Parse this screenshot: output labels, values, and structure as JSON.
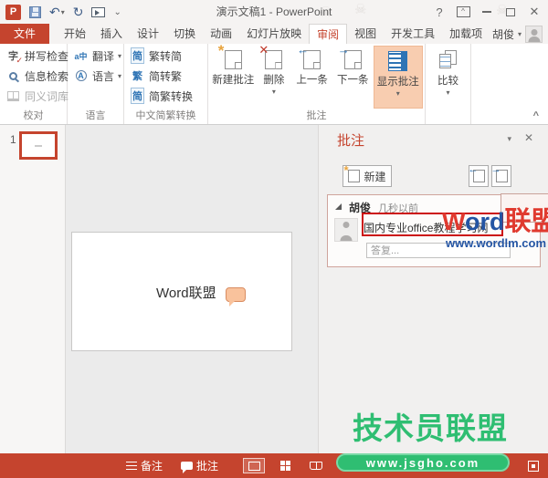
{
  "window": {
    "title": "演示文稿1 - PowerPoint",
    "help": "?",
    "close": "✕"
  },
  "qat": {
    "powerpoint_badge": "P",
    "undo": "↶",
    "redo": "↻",
    "more": "⌄"
  },
  "icons": {
    "caret": "▾",
    "collapse_ribbon": "^",
    "pane_menu": "▾",
    "pane_close": "✕",
    "star": "*",
    "cross": "✕",
    "arrow_left": "←",
    "arrow_right": "→",
    "check": "✓",
    "zi": "字",
    "translate": "a中",
    "globe_letter": "A",
    "jian": "简",
    "fan": "繁",
    "jianfan": "简",
    "skull": "☠"
  },
  "tabs": {
    "file": "文件",
    "home": "开始",
    "insert": "插入",
    "design": "设计",
    "transitions": "切换",
    "animations": "动画",
    "slideshow": "幻灯片放映",
    "review": "审阅",
    "view": "视图",
    "developer": "开发工具",
    "addins": "加载项",
    "account": "胡俊"
  },
  "ribbon": {
    "proofing": {
      "label": "校对",
      "spell": "拼写检查",
      "research": "信息检索",
      "thesaurus": "同义词库"
    },
    "language": {
      "label": "语言",
      "translate": "翻译",
      "language": "语言"
    },
    "conversion": {
      "label": "中文简繁转换",
      "t2s": "繁转简",
      "s2t": "简转繁",
      "convert": "简繁转换"
    },
    "comments": {
      "label": "批注",
      "new": "新建批注",
      "delete": "删除",
      "previous": "上一条",
      "next": "下一条",
      "show": "显示批注"
    },
    "compare": {
      "label": "比较"
    }
  },
  "thumbnails": {
    "slide_number": "1"
  },
  "slide": {
    "text": "Word联盟"
  },
  "comments_pane": {
    "title": "批注",
    "new_button": "新建",
    "author": "胡俊",
    "time": "几秒以前",
    "comment_text": "国内专业office教程学习网",
    "reply_placeholder": "答复..."
  },
  "statusbar": {
    "notes": "备注",
    "comments": "批注"
  },
  "watermarks": {
    "wordlm_w": "W",
    "wordlm_ord": "ord",
    "wordlm_league": "联盟",
    "wordlm_url": "www.wordlm.com",
    "tech_name": "技术员联盟",
    "tech_url": "www.jsgho.com"
  },
  "colors": {
    "accent": "#C5442E",
    "ribbon_highlight": "#F8CDB0",
    "annotation_red": "#CC1111",
    "watermark_green": "#2FBE72",
    "watermark_blue": "#2455A4",
    "watermark_red": "#E03A2F"
  }
}
